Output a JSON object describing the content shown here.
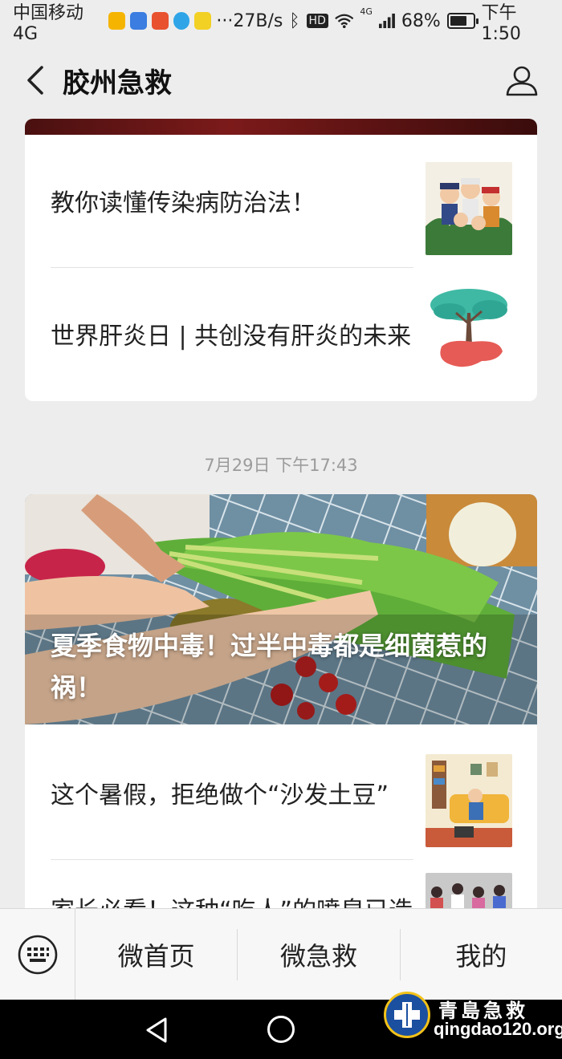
{
  "status_bar": {
    "carrier": "中国移动4G",
    "more": "···",
    "net_speed": "27B/s",
    "hd": "HD",
    "net_type": "4G",
    "battery": "68%",
    "battery_level": 0.68,
    "time": "下午1:50"
  },
  "navbar": {
    "title": "胶州急救"
  },
  "feed": {
    "group1": {
      "articles": [
        {
          "title": "教你读懂传染病防治法！",
          "thumb_icon": "epidemic-workers-illustration"
        },
        {
          "title": "世界肝炎日 | 共创没有肝炎的未来",
          "thumb_icon": "tree-liver-illustration"
        }
      ]
    },
    "group2": {
      "timestamp": "7月29日 下午17:43",
      "hero": {
        "title": "夏季食物中毒！过半中毒都是细菌惹的祸！",
        "image_icon": "celery-hands-photo"
      },
      "articles": [
        {
          "title": "这个暑假，拒绝做个“沙发土豆”",
          "thumb_icon": "sofa-child-illustration"
        },
        {
          "title": "家长必看！这种“吃人”的喷泉已造",
          "thumb_icon": "crowd-photo"
        }
      ]
    }
  },
  "menu": {
    "keyboard_icon": "keyboard-icon",
    "items": [
      "微首页",
      "微急救",
      "我的"
    ]
  },
  "watermark": {
    "cn": "青島急救",
    "url": "qingdao120.org"
  },
  "colors": {
    "background": "#ededed",
    "card": "#ffffff",
    "text": "#222222",
    "timestamp": "#9b9b9b"
  }
}
